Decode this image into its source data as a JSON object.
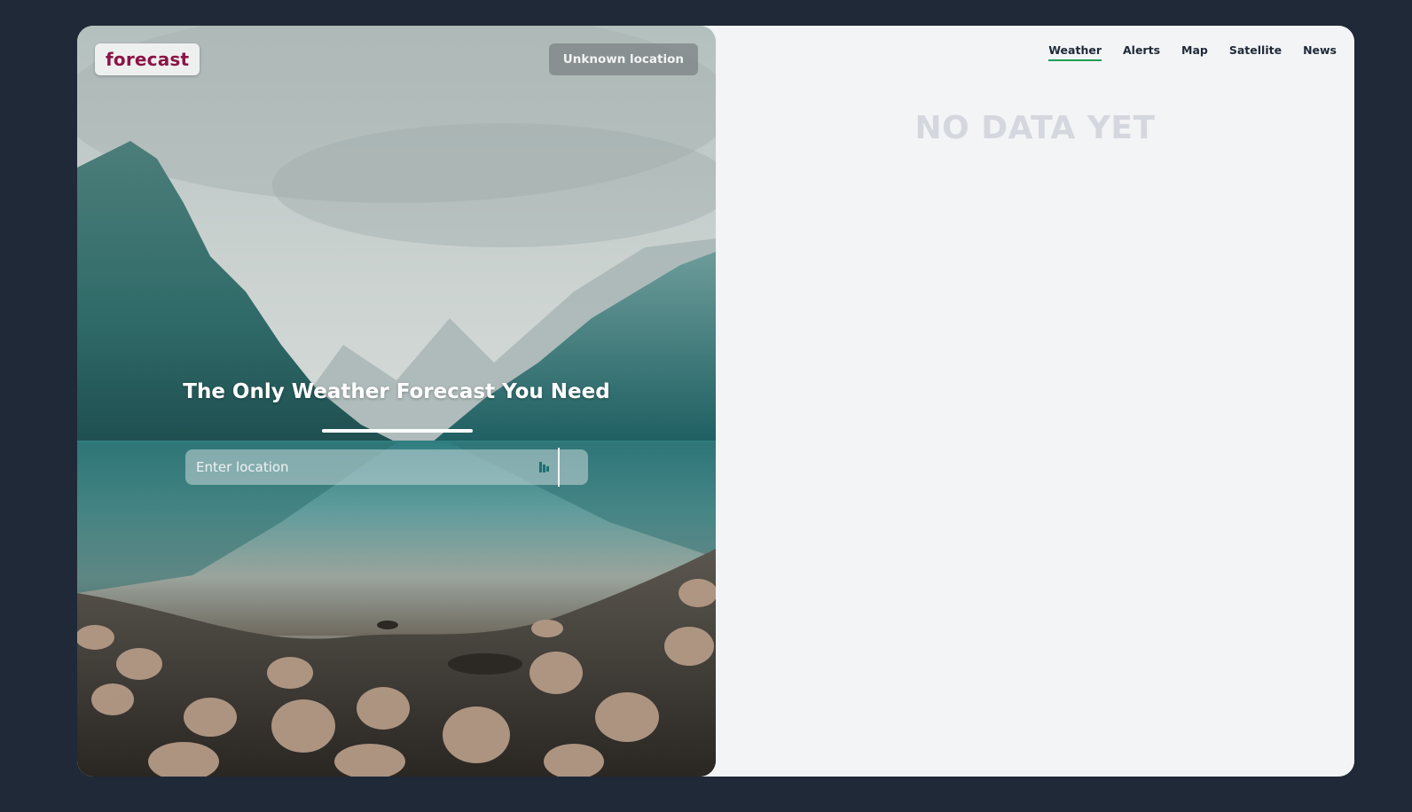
{
  "brand": {
    "logo_text": "forecast",
    "logo_color": "#8b1446"
  },
  "location_badge": {
    "label": "Unknown location"
  },
  "hero": {
    "headline": "The Only Weather Forecast You Need"
  },
  "search": {
    "placeholder": "Enter location",
    "value": "",
    "submit_icon": "search-submit-icon"
  },
  "nav": {
    "items": [
      {
        "label": "Weather",
        "active": true
      },
      {
        "label": "Alerts",
        "active": false
      },
      {
        "label": "Map",
        "active": false
      },
      {
        "label": "Satellite",
        "active": false
      },
      {
        "label": "News",
        "active": false
      }
    ],
    "active_underline_color": "#1f9d55"
  },
  "main": {
    "empty_message": "NO DATA YET"
  },
  "colors": {
    "page_background": "#1f2937",
    "content_background": "#f2f4f6",
    "empty_text": "#d4d8de"
  }
}
